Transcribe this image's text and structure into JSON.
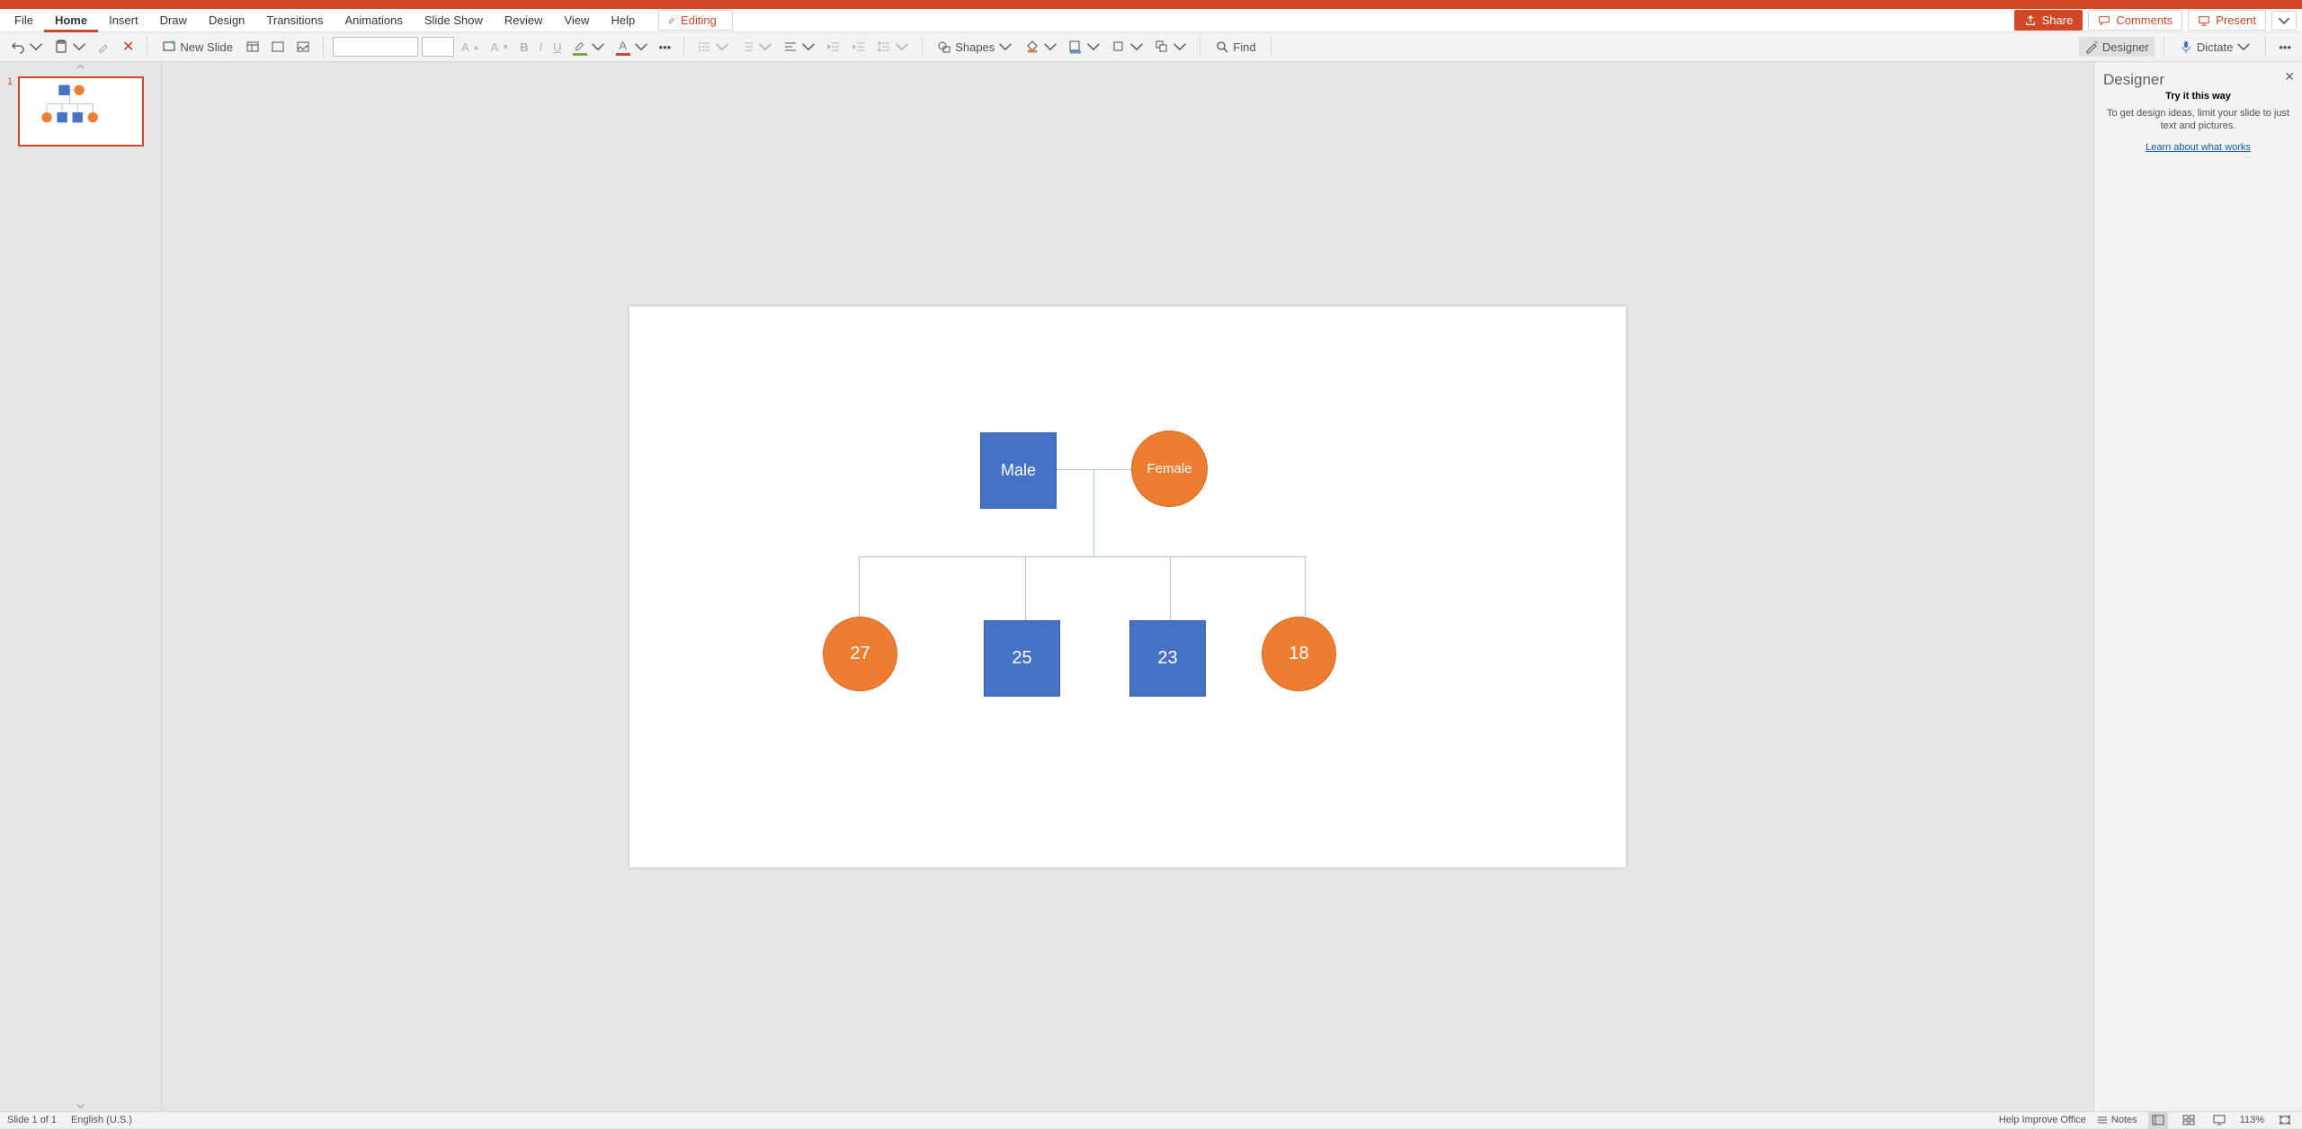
{
  "tabs": {
    "file": "File",
    "home": "Home",
    "insert": "Insert",
    "draw": "Draw",
    "design": "Design",
    "transitions": "Transitions",
    "animations": "Animations",
    "slideshow": "Slide Show",
    "review": "Review",
    "view": "View",
    "help": "Help"
  },
  "editing_label": "Editing",
  "right_buttons": {
    "share": "Share",
    "comments": "Comments",
    "present": "Present"
  },
  "ribbon": {
    "new_slide": "New Slide",
    "shapes": "Shapes",
    "find": "Find",
    "designer": "Designer",
    "dictate": "Dictate"
  },
  "thumb_number": "1",
  "slide_shapes": {
    "male": "Male",
    "female": "Female",
    "child1": "27",
    "child2": "25",
    "child3": "23",
    "child4": "18"
  },
  "designer": {
    "title": "Designer",
    "heading": "Try it this way",
    "desc": "To get design ideas, limit your slide to just text and pictures.",
    "link": "Learn about what works"
  },
  "status": {
    "slide": "Slide 1 of 1",
    "lang": "English (U.S.)",
    "help": "Help Improve Office",
    "notes": "Notes",
    "zoom": "113%"
  }
}
